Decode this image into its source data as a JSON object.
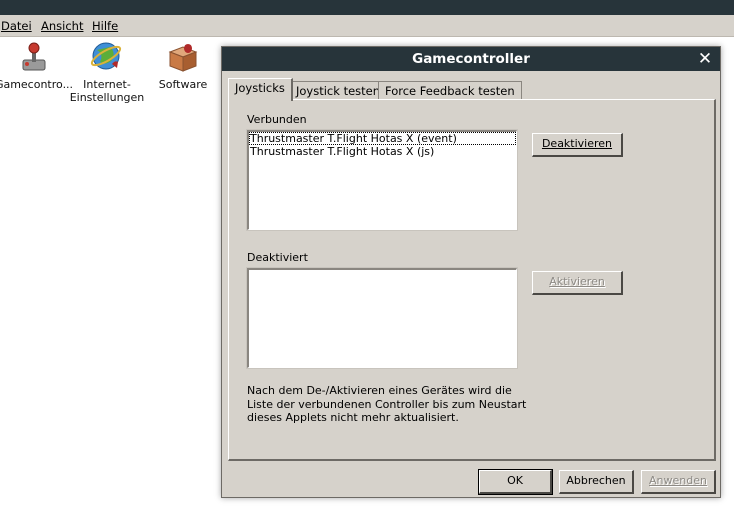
{
  "menubar": {
    "items": [
      {
        "label": "Datei"
      },
      {
        "label": "Ansicht"
      },
      {
        "label": "Hilfe"
      }
    ]
  },
  "desktop": {
    "icons": [
      {
        "label": "Gamecontro...",
        "icon": "joystick-icon"
      },
      {
        "label": "Internet-\nEinstellungen",
        "icon": "internet-globe-icon"
      },
      {
        "label": "Software",
        "icon": "software-box-icon"
      }
    ]
  },
  "dialog": {
    "title": "Gamecontroller",
    "close_glyph": "✕",
    "tabs": [
      {
        "label": "Joysticks",
        "active": true
      },
      {
        "label": "Joystick testen",
        "active": false
      },
      {
        "label": "Force Feedback testen",
        "active": false
      }
    ],
    "connected": {
      "label": "Verbunden",
      "items": [
        "Thrustmaster T.Flight Hotas X (event)",
        "Thrustmaster T.Flight Hotas X (js)"
      ],
      "button": "Deaktivieren"
    },
    "disabled": {
      "label": "Deaktiviert",
      "items": [],
      "button": "Aktivieren"
    },
    "note": "Nach dem De-/Aktivieren eines Gerätes wird die Liste der verbundenen Controller bis zum Neustart dieses Applets nicht mehr aktualisiert.",
    "buttons": {
      "ok": "OK",
      "cancel": "Abbrechen",
      "apply": "Anwenden"
    }
  }
}
